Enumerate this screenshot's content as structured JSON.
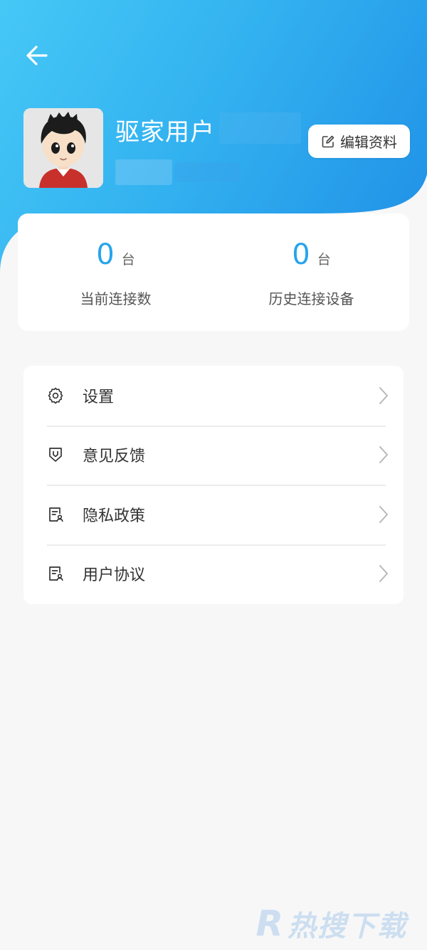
{
  "header": {
    "username": "驱家用户",
    "edit_profile_label": "编辑资料"
  },
  "stats": [
    {
      "value": "0",
      "unit": "台",
      "label": "当前连接数"
    },
    {
      "value": "0",
      "unit": "台",
      "label": "历史连接设备"
    }
  ],
  "menu": [
    {
      "label": "设置",
      "icon": "gear-icon"
    },
    {
      "label": "意见反馈",
      "icon": "feedback-icon"
    },
    {
      "label": "隐私政策",
      "icon": "document-icon"
    },
    {
      "label": "用户协议",
      "icon": "document-icon"
    }
  ],
  "watermark": {
    "text": "热搜下载",
    "logo_letter": "R"
  },
  "colors": {
    "accent": "#27a4ec",
    "header_start": "#46c8f6",
    "header_end": "#1f8fe6",
    "background": "#f7f7f8"
  }
}
